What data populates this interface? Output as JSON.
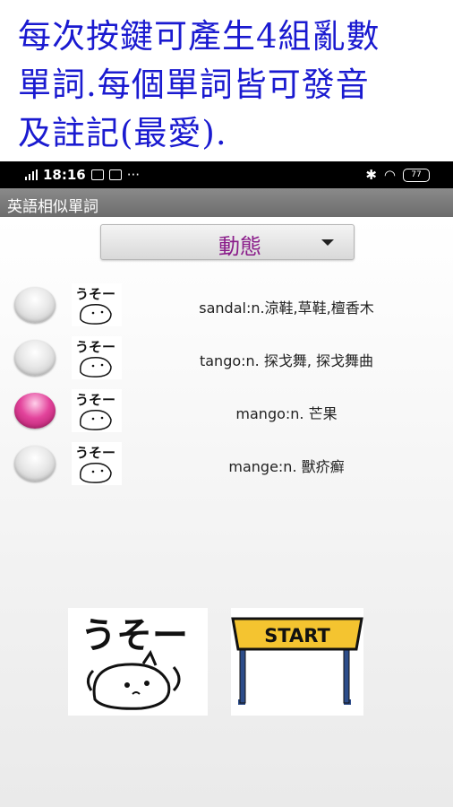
{
  "promo": {
    "line1": "每次按鍵可產生4組亂數",
    "line2": "單詞.每個單詞皆可發音",
    "line3": "及註記(最愛)."
  },
  "status_bar": {
    "time": "18:16",
    "more": "···",
    "battery": "77"
  },
  "app": {
    "title": "英語相似單詞"
  },
  "spinner": {
    "selected": "動態"
  },
  "words": [
    {
      "text": "sandal:n.涼鞋,草鞋,檀香木",
      "checked": false
    },
    {
      "text": "tango:n. 探戈舞, 探戈舞曲",
      "checked": false
    },
    {
      "text": "mango:n. 芒果",
      "checked": true
    },
    {
      "text": "mange:n. 獸疥癬",
      "checked": false
    }
  ],
  "favorite_label": "うそー",
  "start_label": "START",
  "colors": {
    "promo_text": "#1a1ad0",
    "spinner_text": "#8a1c8a",
    "radio_checked": "#e3449c",
    "start_sign": "#f4c430",
    "start_posts": "#2d4d8a"
  }
}
